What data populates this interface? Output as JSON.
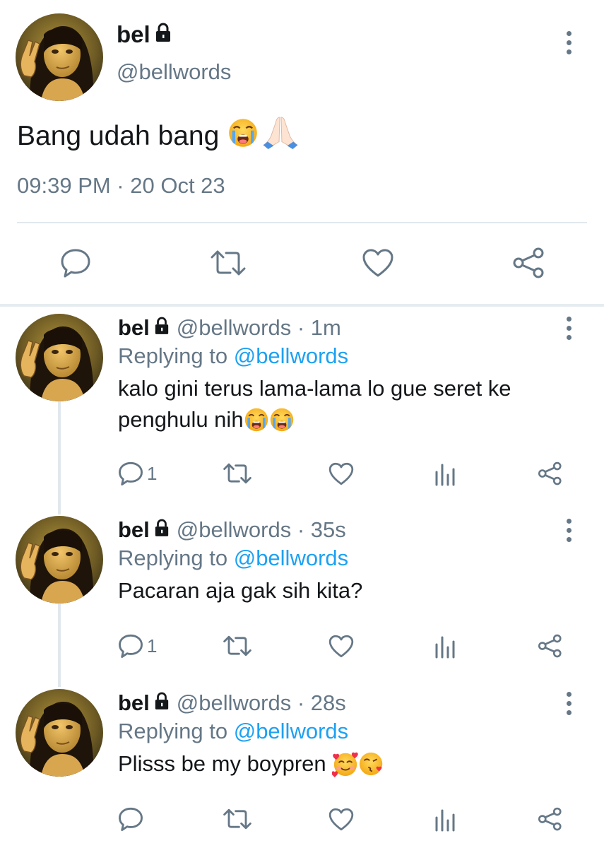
{
  "main_tweet": {
    "display_name": "bel",
    "handle": "@bellwords",
    "text": "Bang udah bang",
    "emojis": [
      "loudly-crying-face",
      "folded-hands"
    ],
    "timestamp": "09:39 PM · 20 Oct 23",
    "icons": [
      "lock-icon",
      "more-icon",
      "reply-icon",
      "retweet-icon",
      "like-icon",
      "share-icon"
    ]
  },
  "replies": [
    {
      "display_name": "bel",
      "meta": "@bellwords · 1m",
      "replying_prefix": "Replying to ",
      "replying_to": "@bellwords",
      "text": "kalo gini terus lama-lama lo gue seret ke penghulu nih",
      "emojis": [
        "loudly-crying-face",
        "loudly-crying-face"
      ],
      "reply_count": "1"
    },
    {
      "display_name": "bel",
      "meta": "@bellwords · 35s",
      "replying_prefix": "Replying to ",
      "replying_to": "@bellwords",
      "text": "Pacaran aja gak sih kita?",
      "emojis": [],
      "reply_count": "1"
    },
    {
      "display_name": "bel",
      "meta": "@bellwords · 28s",
      "replying_prefix": "Replying to ",
      "replying_to": "@bellwords",
      "text": "Plisss be my boypren",
      "emojis": [
        "smiling-face-with-hearts",
        "face-blowing-kiss"
      ],
      "reply_count": ""
    }
  ],
  "colors": {
    "text": "#14171a",
    "secondary": "#657786",
    "link": "#1da1f2",
    "divider": "#e1e8ed"
  }
}
